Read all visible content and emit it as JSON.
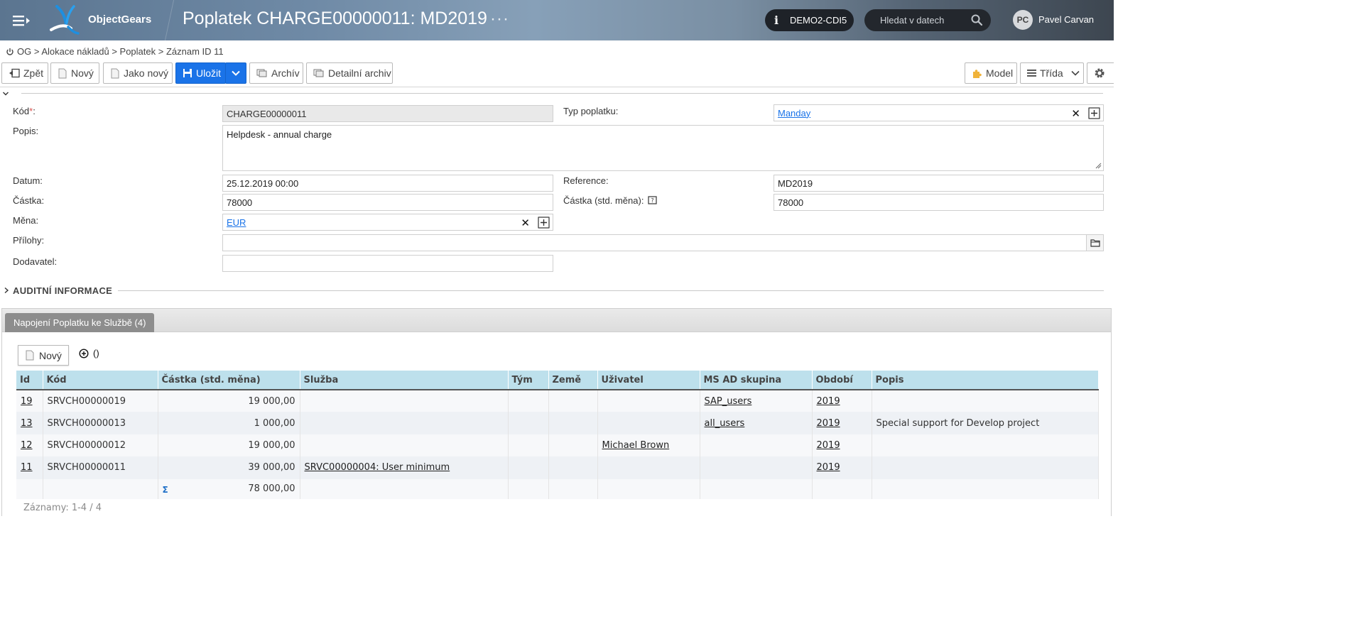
{
  "header": {
    "brand": "ObjectGears",
    "title": "Poplatek CHARGE00000011: MD2019",
    "title_more": "···",
    "environment": "DEMO2-CDI5",
    "search_placeholder": "Hledat v datech",
    "user_initials": "PC",
    "user_name": "Pavel Carvan",
    "icons": [
      "hamburger-icon",
      "info-icon",
      "search-icon"
    ]
  },
  "breadcrumb": {
    "text": "OG > Alokace nákladů > Poplatek > Záznam ID 11"
  },
  "toolbar": {
    "back": "Zpět",
    "new": "Nový",
    "copy": "Jako nový",
    "save": "Uložit",
    "archive": "Archív",
    "detail_archive": "Detailní archiv",
    "model": "Model",
    "class": "Třída"
  },
  "form": {
    "code_label": "Kód",
    "required_mark": "*",
    "code_label_suffix": ":",
    "code_value": "CHARGE00000011",
    "charge_type_label": "Typ poplatku:",
    "charge_type_value": "Manday",
    "description_label": "Popis:",
    "description_value": "Helpdesk - annual charge",
    "date_label": "Datum:",
    "date_value": "25.12.2019 00:00",
    "reference_label": "Reference:",
    "reference_value": "MD2019",
    "amount_label": "Částka:",
    "amount_value": "78000",
    "amount_std_label": "Částka (std. měna):",
    "amount_std_value": "78000",
    "currency_label": "Měna:",
    "currency_value": "EUR",
    "attachments_label": "Přílohy:",
    "attachments_value": "",
    "supplier_label": "Dodavatel:",
    "supplier_value": ""
  },
  "audit": {
    "title": "AUDITNÍ INFORMACE"
  },
  "related": {
    "tab_label": "Napojení Poplatku ke Službě (4)",
    "new_button": "Nový",
    "add_paren": "()",
    "columns": [
      "Id",
      "Kód",
      "Částka (std. měna)",
      "Služba",
      "Tým",
      "Země",
      "Uživatel",
      "MS AD skupina",
      "Období",
      "Popis"
    ],
    "rows": [
      {
        "id": "19",
        "code": "SRVCH00000019",
        "amount": "19 000,00",
        "service": "",
        "team": "",
        "country": "",
        "user": "",
        "group": "SAP_users",
        "period": "2019",
        "description": ""
      },
      {
        "id": "13",
        "code": "SRVCH00000013",
        "amount": "1 000,00",
        "service": "",
        "team": "",
        "country": "",
        "user": "",
        "group": "all_users",
        "period": "2019",
        "description": "Special support for Develop project"
      },
      {
        "id": "12",
        "code": "SRVCH00000012",
        "amount": "19 000,00",
        "service": "",
        "team": "",
        "country": "",
        "user": "Michael Brown",
        "group": "",
        "period": "2019",
        "description": ""
      },
      {
        "id": "11",
        "code": "SRVCH00000011",
        "amount": "39 000,00",
        "service": "SRVC00000004: User minimum",
        "team": "",
        "country": "",
        "user": "",
        "group": "",
        "period": "2019",
        "description": ""
      }
    ],
    "sum_symbol": "Σ",
    "sum_value": "78 000,00",
    "records_text": "Záznamy: 1-4 / 4"
  },
  "colors": {
    "primary": "#1a73e8",
    "grid_header": "#bde0ec",
    "tab": "#8d8d8d",
    "header_dark": "#1e2228"
  }
}
